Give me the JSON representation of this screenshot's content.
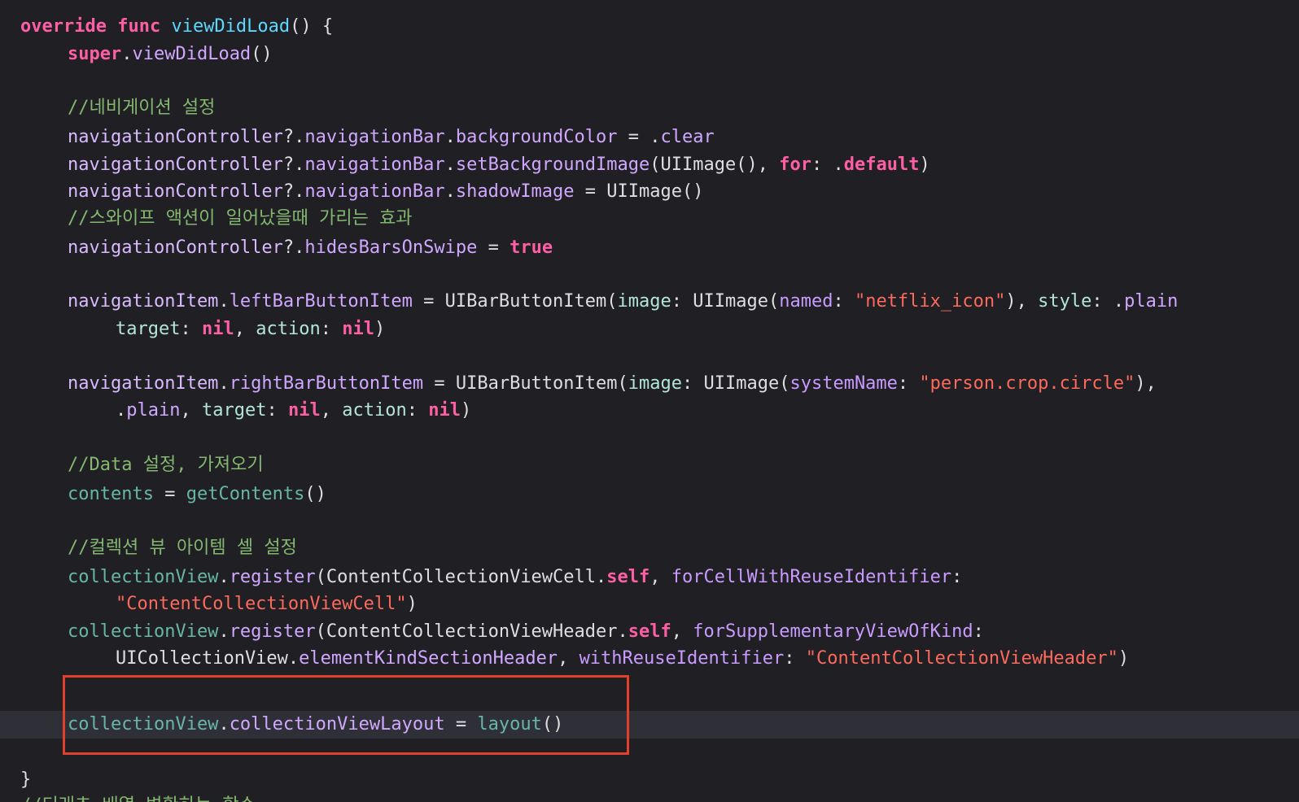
{
  "code": {
    "l01_override": "override",
    "l01_func": "func",
    "l01_name": "viewDidLoad",
    "l01_rest": "() {",
    "l02_super": "super",
    "l02_dot": ".",
    "l02_call": "viewDidLoad",
    "l02_rest": "()",
    "l04_comment": "//네비게이션 설정",
    "l05_nc": "navigationController",
    "l05_q": "?.",
    "l05_bar": "navigationBar",
    "l05_dot": ".",
    "l05_prop": "backgroundColor",
    "l05_eq": " = .",
    "l05_val": "clear",
    "l06_nc": "navigationController",
    "l06_q": "?.",
    "l06_bar": "navigationBar",
    "l06_dot": ".",
    "l06_call": "setBackgroundImage",
    "l06_p1": "(UIImage(), ",
    "l06_for": "for",
    "l06_p2": ": .",
    "l06_def": "default",
    "l06_p3": ")",
    "l07_nc": "navigationController",
    "l07_q": "?.",
    "l07_bar": "navigationBar",
    "l07_dot": ".",
    "l07_prop": "shadowImage",
    "l07_rest": " = UIImage()",
    "l08_comment": "//스와이프 액션이 일어났을때 가리는 효과",
    "l09_nc": "navigationController",
    "l09_q": "?.",
    "l09_prop": "hidesBarsOnSwipe",
    "l09_eq": " = ",
    "l09_true": "true",
    "l11_ni": "navigationItem",
    "l11_dot": ".",
    "l11_prop": "leftBarButtonItem",
    "l11_eq": " = UIBarButtonItem(",
    "l11_image": "image",
    "l11_c1": ": UIImage(",
    "l11_named": "named",
    "l11_c2": ": ",
    "l11_str": "\"netflix_icon\"",
    "l11_c3": "), ",
    "l11_style": "style",
    "l11_c4": ": .",
    "l11_plain": "plain",
    "l12_target": "target",
    "l12_c1": ": ",
    "l12_nil1": "nil",
    "l12_c2": ", ",
    "l12_action": "action",
    "l12_c3": ": ",
    "l12_nil2": "nil",
    "l12_c4": ")",
    "l14_ni": "navigationItem",
    "l14_dot": ".",
    "l14_prop": "rightBarButtonItem",
    "l14_eq": " = UIBarButtonItem(",
    "l14_image": "image",
    "l14_c1": ": UIImage(",
    "l14_sys": "systemName",
    "l14_c2": ": ",
    "l14_str": "\"person.crop.circle\"",
    "l14_c3": "), ",
    "l15_dot": ".",
    "l15_plain": "plain",
    "l15_c1": ", ",
    "l15_target": "target",
    "l15_c2": ": ",
    "l15_nil1": "nil",
    "l15_c3": ", ",
    "l15_action": "action",
    "l15_c4": ": ",
    "l15_nil2": "nil",
    "l15_c5": ")",
    "l17_comment": "//Data 설정, 가져오기",
    "l18_contents": "contents",
    "l18_eq": " = ",
    "l18_call": "getContents",
    "l18_rest": "()",
    "l20_comment": "//컬렉션 뷰 아이템 셀 설정",
    "l21_cv": "collectionView",
    "l21_dot": ".",
    "l21_call": "register",
    "l21_p1": "(ContentCollectionViewCell.",
    "l21_self": "self",
    "l21_p2": ", ",
    "l21_label": "forCellWithReuseIdentifier",
    "l21_p3": ":",
    "l22_str": "\"ContentCollectionViewCell\"",
    "l22_rest": ")",
    "l23_cv": "collectionView",
    "l23_dot": ".",
    "l23_call": "register",
    "l23_p1": "(ContentCollectionViewHeader.",
    "l23_self": "self",
    "l23_p2": ", ",
    "l23_label": "forSupplementaryViewOfKind",
    "l23_p3": ":",
    "l24_type": "UICollectionView",
    "l24_dot": ".",
    "l24_prop": "elementKindSectionHeader",
    "l24_c1": ", ",
    "l24_label": "withReuseIdentifier",
    "l24_c2": ": ",
    "l24_str": "\"ContentCollectionViewHeader\"",
    "l24_c3": ")",
    "l26_cv": "collectionView",
    "l26_dot": ".",
    "l26_prop": "collectionViewLayout",
    "l26_eq": " = ",
    "l26_call": "layout",
    "l26_rest": "()",
    "l28_brace": "}",
    "l29_comment": "//디래츠 배열 변환하는 함수"
  }
}
